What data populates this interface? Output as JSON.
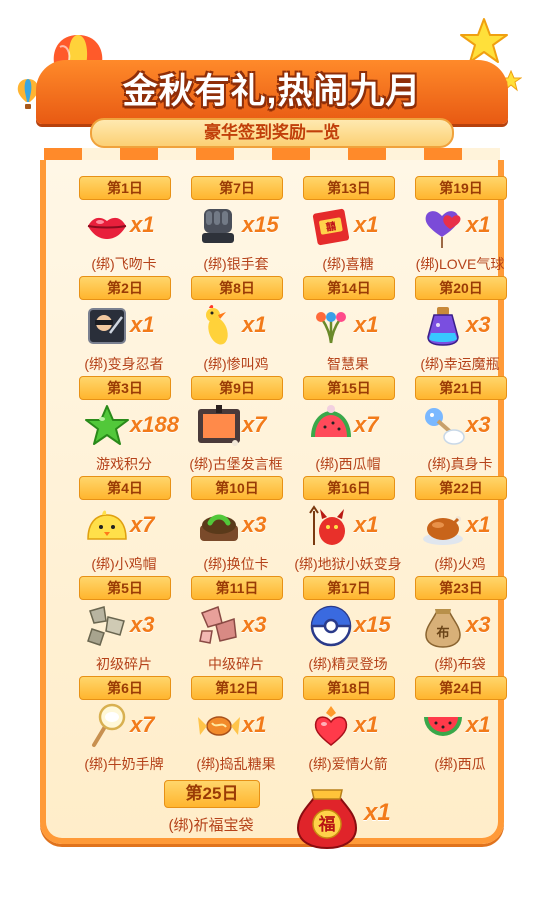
{
  "header": {
    "title": "金秋有礼,热闹九月",
    "subtitle": "豪华签到奖励一览"
  },
  "colors": {
    "accent": "#ff8a2a",
    "title_text": "#ffffff",
    "subtitle_text": "#c13f0a",
    "badge": "#ffc44a",
    "count_text": "#f27b1a",
    "name_text": "#b5421a",
    "board_bg": "#fff7e6"
  },
  "rewards": [
    {
      "day": "第1日",
      "count": "x1",
      "name": "(绑)飞吻卡",
      "icon": "lips-icon"
    },
    {
      "day": "第7日",
      "count": "x15",
      "name": "(绑)银手套",
      "icon": "glove-icon"
    },
    {
      "day": "第13日",
      "count": "x1",
      "name": "(绑)喜糖",
      "icon": "wedding-candy-icon"
    },
    {
      "day": "第19日",
      "count": "x1",
      "name": "(绑)LOVE气球",
      "icon": "love-balloon-icon"
    },
    {
      "day": "第2日",
      "count": "x1",
      "name": "(绑)变身忍者",
      "icon": "ninja-card-icon"
    },
    {
      "day": "第8日",
      "count": "x1",
      "name": "(绑)惨叫鸡",
      "icon": "screaming-chicken-icon"
    },
    {
      "day": "第14日",
      "count": "x1",
      "name": "智慧果",
      "icon": "wisdom-fruit-icon"
    },
    {
      "day": "第20日",
      "count": "x3",
      "name": "(绑)幸运魔瓶",
      "icon": "magic-bottle-icon"
    },
    {
      "day": "第3日",
      "count": "x188",
      "name": "游戏积分",
      "icon": "green-star-icon"
    },
    {
      "day": "第9日",
      "count": "x7",
      "name": "(绑)古堡发言框",
      "icon": "castle-frame-icon"
    },
    {
      "day": "第15日",
      "count": "x7",
      "name": "(绑)西瓜帽",
      "icon": "watermelon-hat-icon"
    },
    {
      "day": "第21日",
      "count": "x3",
      "name": "(绑)真身卡",
      "icon": "true-body-card-icon"
    },
    {
      "day": "第4日",
      "count": "x7",
      "name": "(绑)小鸡帽",
      "icon": "chick-hat-icon"
    },
    {
      "day": "第10日",
      "count": "x3",
      "name": "(绑)换位卡",
      "icon": "swap-card-icon"
    },
    {
      "day": "第16日",
      "count": "x1",
      "name": "(绑)地狱小妖变身",
      "icon": "hell-imp-icon"
    },
    {
      "day": "第22日",
      "count": "x1",
      "name": "(绑)火鸡",
      "icon": "roast-turkey-icon"
    },
    {
      "day": "第5日",
      "count": "x3",
      "name": "初级碎片",
      "icon": "basic-shard-icon"
    },
    {
      "day": "第11日",
      "count": "x3",
      "name": "中级碎片",
      "icon": "mid-shard-icon"
    },
    {
      "day": "第17日",
      "count": "x15",
      "name": "(绑)精灵登场",
      "icon": "spirit-ball-icon"
    },
    {
      "day": "第23日",
      "count": "x3",
      "name": "(绑)布袋",
      "icon": "cloth-bag-icon"
    },
    {
      "day": "第6日",
      "count": "x7",
      "name": "(绑)牛奶手牌",
      "icon": "milk-sign-icon"
    },
    {
      "day": "第12日",
      "count": "x1",
      "name": "(绑)捣乱糖果",
      "icon": "prank-candy-icon"
    },
    {
      "day": "第18日",
      "count": "x1",
      "name": "(绑)爱情火箭",
      "icon": "love-rocket-icon"
    },
    {
      "day": "第24日",
      "count": "x1",
      "name": "(绑)西瓜",
      "icon": "watermelon-icon"
    }
  ],
  "final_reward": {
    "day": "第25日",
    "count": "x1",
    "name": "(绑)祈福宝袋",
    "icon": "lucky-bag-icon",
    "bag_glyph": "福"
  }
}
